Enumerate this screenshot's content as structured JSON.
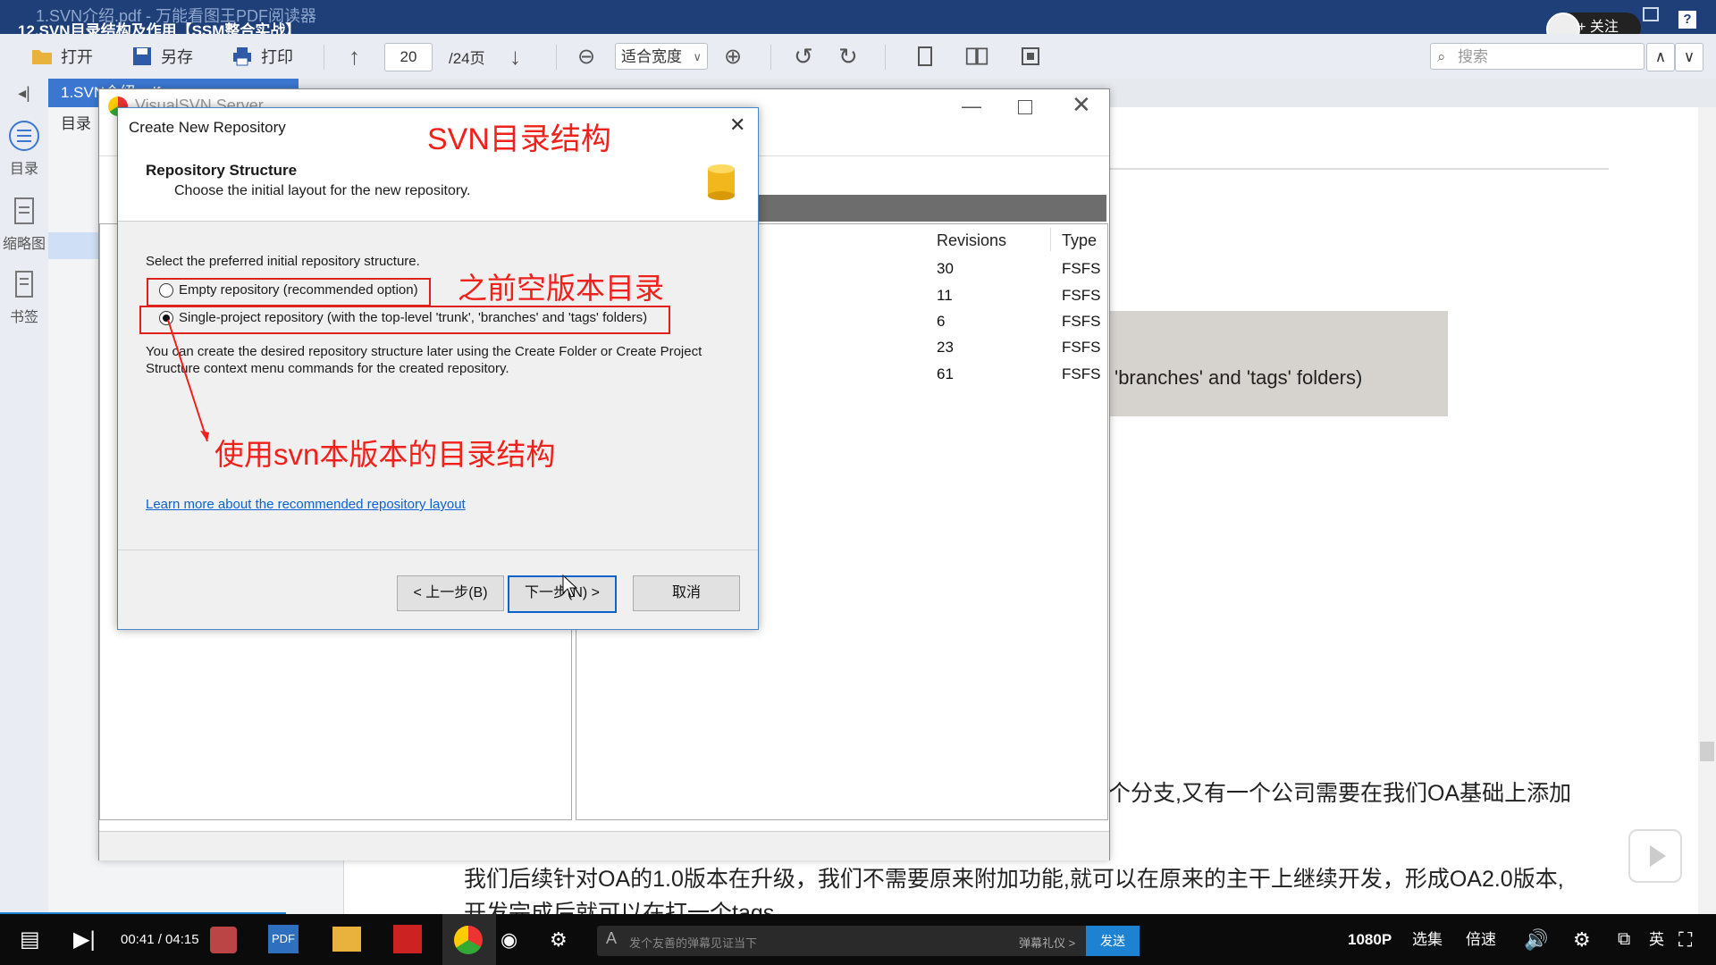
{
  "window": {
    "title_faded": "1.SVN介绍.pdf - 万能看图王PDF阅读器",
    "title": "12.SVN目录结构及作用【SSM整合实战】",
    "follow_label": "+ 关注"
  },
  "toolbar": {
    "open_label": "打开",
    "saveas_label": "另存",
    "print_label": "打印",
    "page_current": "20",
    "page_total": "/24页",
    "zoom_mode": "适合宽度",
    "search_placeholder": "搜索"
  },
  "left_strip": {
    "toc_label": "目录",
    "thumbs_label": "缩略图",
    "bookmark_label": "书签"
  },
  "tabs": [
    {
      "label": "1.SVN介绍.pdf"
    }
  ],
  "toc_header": "目录",
  "visualsvn": {
    "title": "VisualSVN Server",
    "columns": [
      "Revisions",
      "Type"
    ],
    "rows": [
      {
        "revisions": "30",
        "type": "FSFS"
      },
      {
        "revisions": "11",
        "type": "FSFS"
      },
      {
        "revisions": "6",
        "type": "FSFS"
      },
      {
        "revisions": "23",
        "type": "FSFS"
      },
      {
        "revisions": "61",
        "type": "FSFS"
      }
    ]
  },
  "pdf_text": {
    "gray_box_text": "'branches' and 'tags' folders)",
    "line1": "个分支,又有一个公司需要在我们OA基础上添加",
    "line2": "我们后续针对OA的1.0版本在升级，我们不需要原来附加功能,就可以在原来的主干上继续开发，形成OA2.0版本,",
    "line3": "开发完成后就可以在打一个tags"
  },
  "dialog": {
    "title": "Create New Repository",
    "heading": "Repository Structure",
    "subheading": "Choose the initial layout for the new repository.",
    "prompt": "Select the preferred initial repository structure.",
    "option_empty": "Empty repository (recommended option)",
    "option_single": "Single-project repository (with the top-level 'trunk', 'branches' and 'tags' folders)",
    "note_line1": "You can create the desired repository structure later using the Create Folder or Create Project",
    "note_line2": "Structure context menu commands for the created repository.",
    "learn_more": "Learn more about the recommended repository layout",
    "back_label": "< 上一步(B)",
    "next_label": "下一步(N) >",
    "cancel_label": "取消"
  },
  "annotations": {
    "title": "SVN目录结构",
    "empty_note": "之前空版本目录",
    "single_note": "使用svn本版本的目录结构"
  },
  "player": {
    "time": "00:41 / 04:15",
    "danmu_placeholder": "发个友善的弹幕见证当下",
    "danmu_etiquette": "弹幕礼仪 >",
    "send_label": "发送",
    "quality": "1080P",
    "episodes": "选集",
    "speed": "倍速",
    "lang": "英"
  },
  "colors": {
    "annotation_red": "#f0201a",
    "title_bar": "#1e3f78",
    "tab_active": "#3b77d1",
    "send_button": "#1e82d2"
  }
}
